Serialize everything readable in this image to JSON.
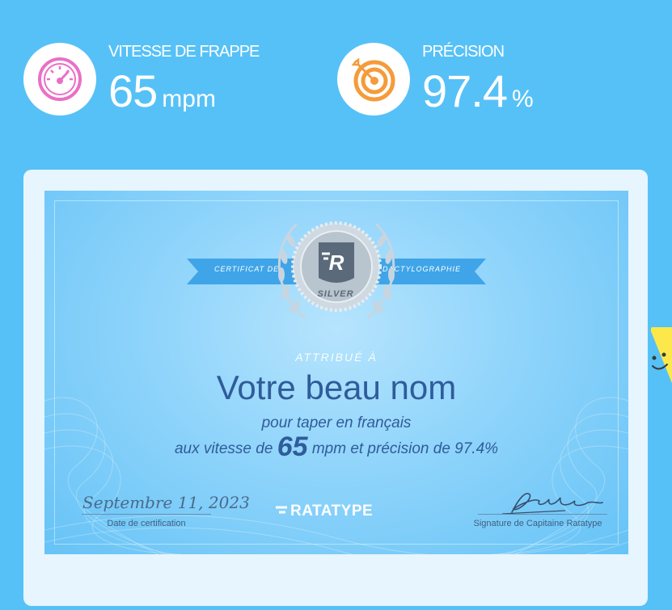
{
  "stats": {
    "speed": {
      "label": "VITESSE DE FRAPPE",
      "value": "65",
      "unit": "mpm",
      "icon": "speedometer-icon",
      "icon_color": "#ea6fc7"
    },
    "accuracy": {
      "label": "PRÉCISION",
      "value": "97.4",
      "unit": "%",
      "icon": "target-icon",
      "icon_color": "#f59b3a"
    }
  },
  "certificate": {
    "ribbon_left": "CERTIFICAT DE",
    "ribbon_right": "DACTYLOGRAPHIE",
    "seal_level": "SILVER",
    "awarded_to": "ATTRIBUÉ À",
    "recipient": "Votre beau nom",
    "line1": "pour taper en français",
    "line2_prefix": "aux vitesse de",
    "line2_speed": "65",
    "line2_suffix": "mpm et précision de 97.4%",
    "date": "Septembre 11, 2023",
    "date_caption": "Date de certification",
    "brand": "RATATYPE",
    "signature_caption": "Signature de Capitaine Ratatype"
  },
  "colors": {
    "page_bg": "#56c1f7",
    "card_bg": "#e6f5fe",
    "certificate_text": "#2f5c9a",
    "sticker": "#fde84b"
  }
}
